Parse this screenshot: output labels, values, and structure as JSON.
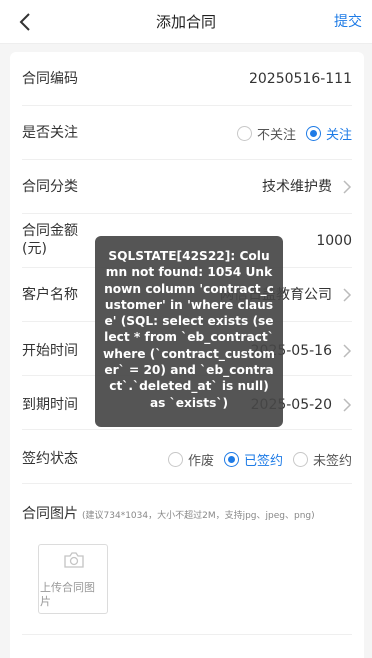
{
  "header": {
    "title": "添加合同",
    "submit_label": "提交"
  },
  "form": {
    "contract_no": {
      "label": "合同编码",
      "value": "20250516-111"
    },
    "follow": {
      "label": "是否关注",
      "options": [
        "不关注",
        "关注"
      ],
      "selected": "关注"
    },
    "category": {
      "label": "合同分类",
      "value": "技术维护费"
    },
    "amount": {
      "label": "合同金额\n(元)",
      "value": "1000"
    },
    "customer": {
      "label": "客户名称",
      "value": "网信日盖教育公司"
    },
    "start_date": {
      "label": "开始时间",
      "value": "2025-05-16"
    },
    "end_date": {
      "label": "到期时间",
      "value": "2025-05-20"
    },
    "sign_status": {
      "label": "签约状态",
      "options": [
        "作废",
        "已签约",
        "未签约"
      ],
      "selected": "已签约"
    },
    "images": {
      "label": "合同图片",
      "hint": "(建议734*1034，大小不超过2M，支持jpg、jpeg、png)",
      "upload_label": "上传合同图片"
    }
  },
  "error_toast": "SQLSTATE[42S22]: Column not found: 1054 Unknown column 'contract_customer' in 'where clause' (SQL: select exists (select * from `eb_contract` where (`contract_customer` = 20) and `eb_contract`.`deleted_at` is null) as `exists`)",
  "colors": {
    "accent": "#1e7be6",
    "toast_bg": "#464646"
  }
}
